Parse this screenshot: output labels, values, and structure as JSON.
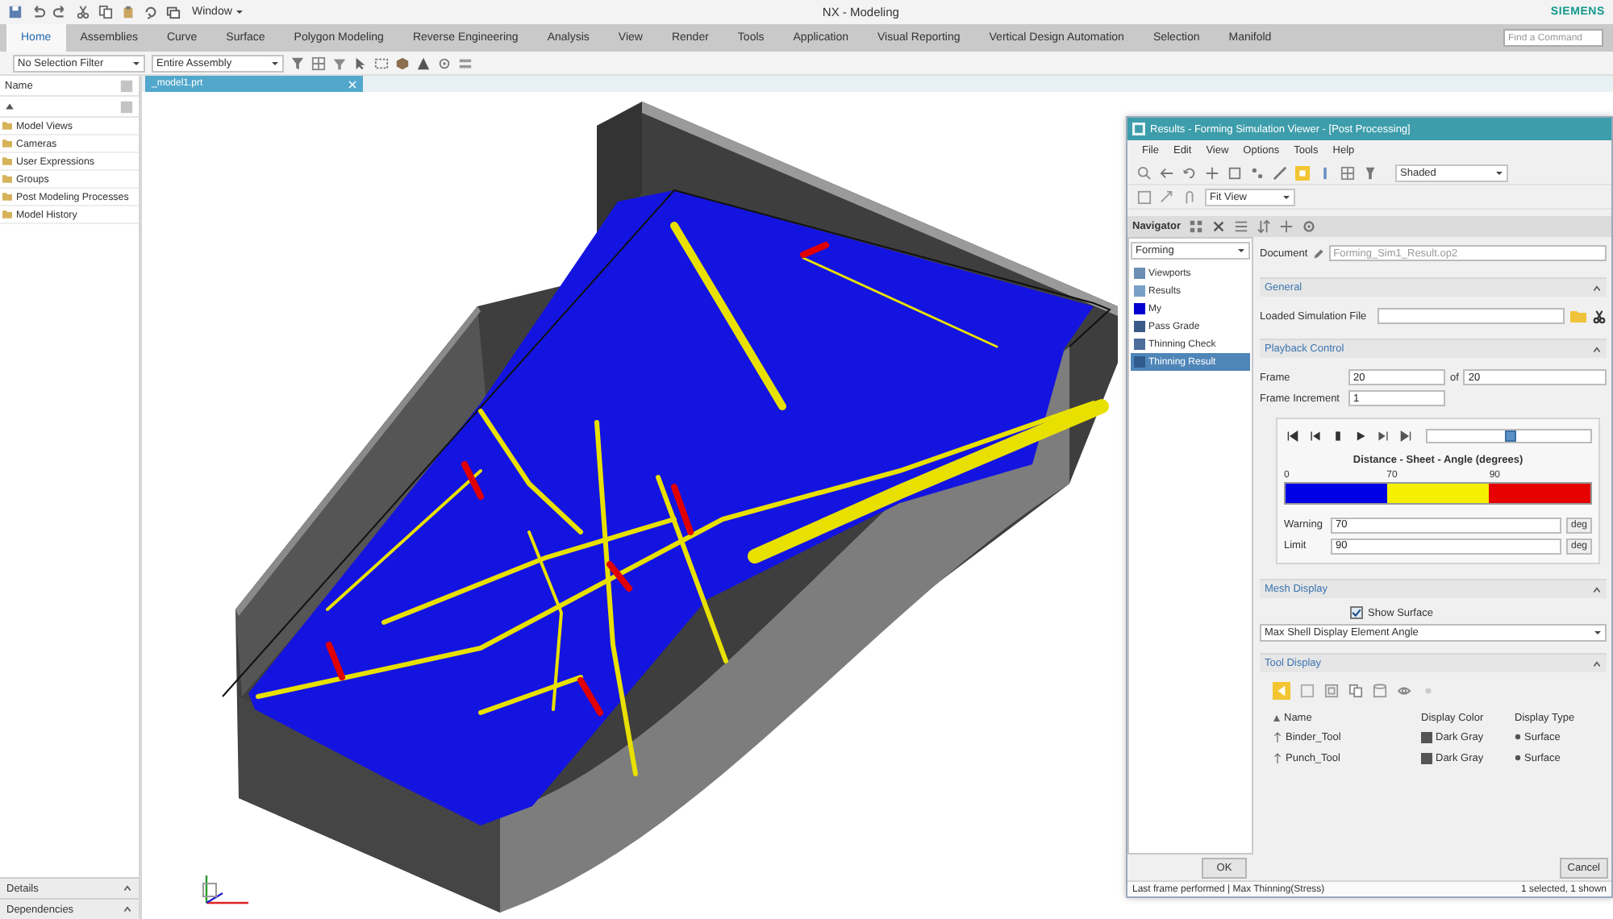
{
  "title_bar": {
    "window_menu": "Window",
    "title": "NX - Modeling",
    "brand": "SIEMENS"
  },
  "ribbon_tabs": [
    {
      "label": "Home",
      "selected": true
    },
    {
      "label": "Assemblies",
      "selected": false
    },
    {
      "label": "Curve",
      "selected": false
    },
    {
      "label": "Surface",
      "selected": false
    },
    {
      "label": "Polygon Modeling",
      "selected": false
    },
    {
      "label": "Reverse Engineering",
      "selected": false
    },
    {
      "label": "Analysis",
      "selected": false
    },
    {
      "label": "View",
      "selected": false
    },
    {
      "label": "Render",
      "selected": false
    },
    {
      "label": "Tools",
      "selected": false
    },
    {
      "label": "Application",
      "selected": false
    },
    {
      "label": "Visual Reporting",
      "selected": false
    },
    {
      "label": "Vertical Design Automation",
      "selected": false
    },
    {
      "label": "Selection",
      "selected": false
    },
    {
      "label": "Manifold",
      "selected": false
    }
  ],
  "command_search": {
    "placeholder": "Find a Command"
  },
  "selection_bar": {
    "filter": "No Selection Filter",
    "scope": "Entire Assembly"
  },
  "part_navigator": {
    "column": "Name",
    "items": [
      "Model Views",
      "Cameras",
      "User Expressions",
      "Groups",
      "Post Modeling Processes",
      "Model History"
    ],
    "panels": [
      "Details",
      "Dependencies"
    ]
  },
  "viewport": {
    "tab": "_model1.prt"
  },
  "dialog": {
    "title": "Results - Forming Simulation Viewer - [Post Processing]",
    "menu": [
      "File",
      "Edit",
      "View",
      "Options",
      "Tools",
      "Help"
    ],
    "render_mode": "Shaded",
    "view_fit": "Fit View",
    "navigator": {
      "label": "Navigator",
      "filter": "Forming",
      "items": [
        {
          "label": "Viewports",
          "selected": false
        },
        {
          "label": "Results",
          "selected": false
        },
        {
          "label": "My",
          "selected": false
        },
        {
          "label": "Pass Grade",
          "selected": false
        },
        {
          "label": "Thinning Check",
          "selected": false
        },
        {
          "label": "Thinning Result",
          "selected": true
        }
      ]
    },
    "document": {
      "label": "Document",
      "placeholder": "Forming_Sim1_Result.op2"
    },
    "general": {
      "header": "General",
      "file_label": "Loaded Simulation File"
    },
    "playback": {
      "header": "Playback Control",
      "frame_label": "Frame",
      "frame": "20",
      "of_label": "of",
      "frame_total": "20",
      "increment_label": "Frame Increment",
      "increment": "1",
      "slider": {
        "level": 0.5
      },
      "legend": {
        "title": "Distance - Sheet - Angle (degrees)",
        "ticks": [
          "0",
          "70",
          "90"
        ],
        "bands": [
          {
            "color": "#0000e6"
          },
          {
            "color": "#f5ef00"
          },
          {
            "color": "#e60000"
          }
        ]
      },
      "warning": {
        "label": "Warning",
        "value": "70",
        "unit": "deg"
      },
      "limit": {
        "label": "Limit",
        "value": "90",
        "unit": "deg"
      }
    },
    "mesh_display": {
      "header": "Mesh Display",
      "show_surface": {
        "label": "Show Surface",
        "checked": true
      },
      "display_mode": "Max Shell Display Element Angle"
    },
    "tool_display": {
      "header": "Tool Display",
      "columns": [
        "Name",
        "Display Color",
        "Display Type"
      ],
      "rows": [
        {
          "name": "Binder_Tool",
          "color": "#555555",
          "color_label": "Dark Gray",
          "type": "Surface"
        },
        {
          "name": "Punch_Tool",
          "color": "#555555",
          "color_label": "Dark Gray",
          "type": "Surface"
        }
      ]
    },
    "buttons": [
      "OK",
      "Cancel"
    ],
    "status": {
      "left": "Last frame performed | Max Thinning(Stress)",
      "right": "1 selected, 1 shown"
    }
  }
}
